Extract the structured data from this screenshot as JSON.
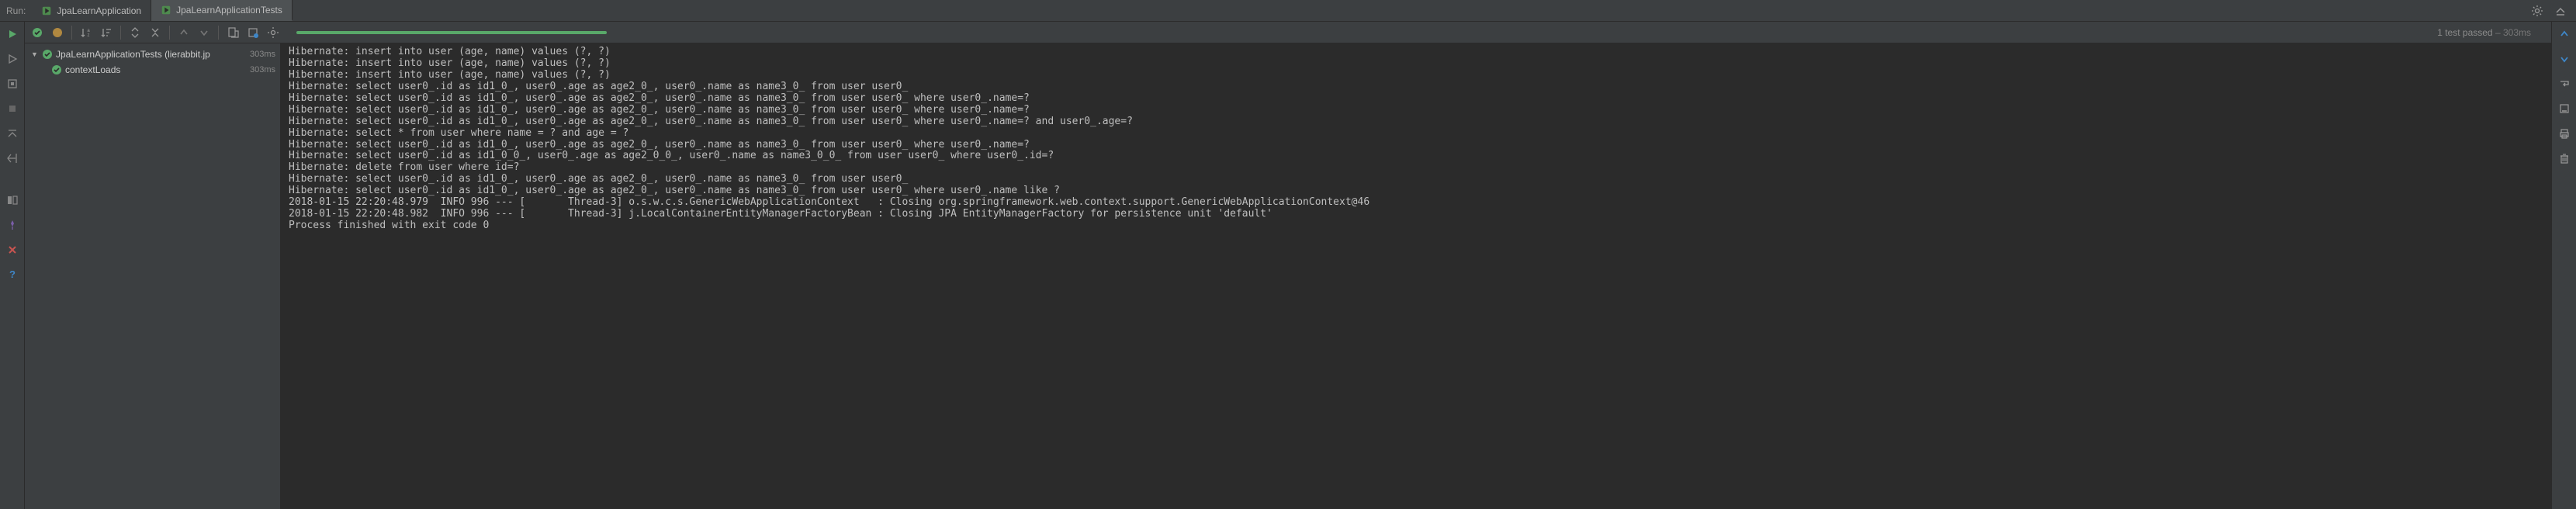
{
  "run_label": "Run:",
  "tabs": [
    {
      "label": "JpaLearnApplication",
      "active": false
    },
    {
      "label": "JpaLearnApplicationTests",
      "active": true
    }
  ],
  "status": {
    "passed_text": "1 test passed",
    "time_text": "303ms"
  },
  "tree": {
    "class_name": "JpaLearnApplicationTests (lierabbit.jp",
    "class_ms": "303ms",
    "test_name": "contextLoads",
    "test_ms": "303ms"
  },
  "console_lines": [
    "Hibernate: insert into user (age, name) values (?, ?)",
    "Hibernate: insert into user (age, name) values (?, ?)",
    "Hibernate: insert into user (age, name) values (?, ?)",
    "Hibernate: select user0_.id as id1_0_, user0_.age as age2_0_, user0_.name as name3_0_ from user user0_",
    "Hibernate: select user0_.id as id1_0_, user0_.age as age2_0_, user0_.name as name3_0_ from user user0_ where user0_.name=?",
    "Hibernate: select user0_.id as id1_0_, user0_.age as age2_0_, user0_.name as name3_0_ from user user0_ where user0_.name=?",
    "Hibernate: select user0_.id as id1_0_, user0_.age as age2_0_, user0_.name as name3_0_ from user user0_ where user0_.name=? and user0_.age=?",
    "Hibernate: select * from user where name = ? and age = ?",
    "Hibernate: select user0_.id as id1_0_, user0_.age as age2_0_, user0_.name as name3_0_ from user user0_ where user0_.name=?",
    "Hibernate: select user0_.id as id1_0_0_, user0_.age as age2_0_0_, user0_.name as name3_0_0_ from user user0_ where user0_.id=?",
    "Hibernate: delete from user where id=?",
    "Hibernate: select user0_.id as id1_0_, user0_.age as age2_0_, user0_.name as name3_0_ from user user0_",
    "Hibernate: select user0_.id as id1_0_, user0_.age as age2_0_, user0_.name as name3_0_ from user user0_ where user0_.name like ?",
    "2018-01-15 22:20:48.979  INFO 996 --- [       Thread-3] o.s.w.c.s.GenericWebApplicationContext   : Closing org.springframework.web.context.support.GenericWebApplicationContext@46",
    "2018-01-15 22:20:48.982  INFO 996 --- [       Thread-3] j.LocalContainerEntityManagerFactoryBean : Closing JPA EntityManagerFactory for persistence unit 'default'",
    "",
    "Process finished with exit code 0"
  ]
}
